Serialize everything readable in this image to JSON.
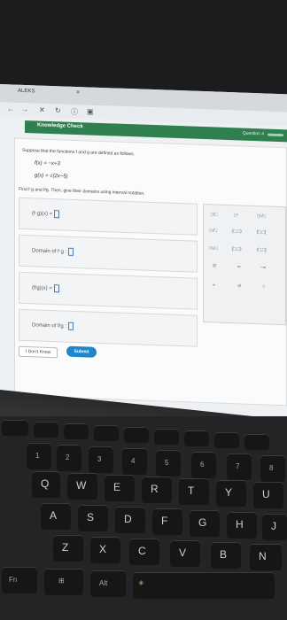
{
  "browser": {
    "tab_title": "ALEKS",
    "tab_close": "×",
    "nav_icons": [
      "back-icon",
      "forward-icon",
      "close-icon",
      "reload-icon",
      "info-icon",
      "bookmark-icon"
    ]
  },
  "header": {
    "title": "Knowledge Check",
    "question_label": "Question 4"
  },
  "problem": {
    "intro": "Suppose that the functions f and g are defined as follows.",
    "f_def": "f(x) = −x+3",
    "g_def": "g(x) = √(2x−5)",
    "instruction": "Find f·g and f/g. Then, give their domains using interval notation.",
    "box1_label": "(f·g)(x) =",
    "box2_label": "Domain of f·g :",
    "box3_label": "(f/g)(x) =",
    "box4_label": "Domain of f/g :"
  },
  "keypad": {
    "row1": [
      "□/□",
      "□ⁿ",
      "□/√□"
    ],
    "row2": [
      "□√□",
      "(□,□)",
      "[□,□]"
    ],
    "row3": [
      "□∪□",
      "[□,□)",
      "(□,□]"
    ],
    "row4": [
      "∅",
      "∞",
      "−∞"
    ],
    "row5": [
      "×",
      "↺",
      "?"
    ]
  },
  "buttons": {
    "dont_know": "I Don't Know",
    "submit": "Submit"
  },
  "keyboard": {
    "row_numbers": [
      "1",
      "2",
      "3",
      "4",
      "5",
      "6",
      "7",
      "8"
    ],
    "row_top": [
      "Q",
      "W",
      "E",
      "R",
      "T",
      "Y",
      "U"
    ],
    "row_mid": [
      "A",
      "S",
      "D",
      "F",
      "G",
      "H",
      "J"
    ],
    "row_low": [
      "Z",
      "X",
      "C",
      "V",
      "B",
      "N"
    ],
    "bottom": [
      "Fn",
      "Alt"
    ]
  }
}
